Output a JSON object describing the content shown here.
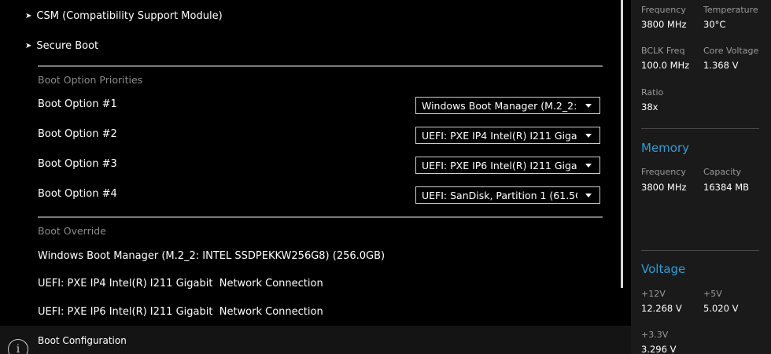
{
  "submenus": [
    {
      "label": "CSM (Compatibility Support Module)"
    },
    {
      "label": "Secure Boot"
    }
  ],
  "boot_priorities": {
    "title": "Boot Option Priorities",
    "options": [
      {
        "label": "Boot Option #1",
        "value": "Windows Boot Manager (M.2_2:"
      },
      {
        "label": "Boot Option #2",
        "value": "UEFI: PXE IP4 Intel(R) I211 Gigal"
      },
      {
        "label": "Boot Option #3",
        "value": "UEFI: PXE IP6 Intel(R) I211 Gigal"
      },
      {
        "label": "Boot Option #4",
        "value": "UEFI: SanDisk, Partition 1 (61.5C"
      }
    ]
  },
  "boot_override": {
    "title": "Boot Override",
    "items": [
      "Windows Boot Manager (M.2_2: INTEL SSDPEKKW256G8) (256.0GB)",
      "UEFI: PXE IP4 Intel(R) I211 Gigabit  Network Connection",
      "UEFI: PXE IP6 Intel(R) I211 Gigabit  Network Connection"
    ]
  },
  "help": {
    "text": "Boot Configuration",
    "icon": "info-icon"
  },
  "hardware_monitor": {
    "cpu": {
      "frequency_label": "Frequency",
      "frequency": "3800 MHz",
      "temperature_label": "Temperature",
      "temperature": "30°C",
      "bclk_label": "BCLK Freq",
      "bclk": "100.0 MHz",
      "core_voltage_label": "Core Voltage",
      "core_voltage": "1.368 V",
      "ratio_label": "Ratio",
      "ratio": "38x"
    },
    "memory": {
      "title": "Memory",
      "frequency_label": "Frequency",
      "frequency": "3800 MHz",
      "capacity_label": "Capacity",
      "capacity": "16384 MB"
    },
    "voltage": {
      "title": "Voltage",
      "v12_label": "+12V",
      "v12": "12.268 V",
      "v5_label": "+5V",
      "v5": "5.020 V",
      "v33_label": "+3.3V",
      "v33": "3.296 V"
    }
  },
  "colors": {
    "accent": "#28a0d8",
    "background": "#000000",
    "panel": "#1a1a1a"
  }
}
